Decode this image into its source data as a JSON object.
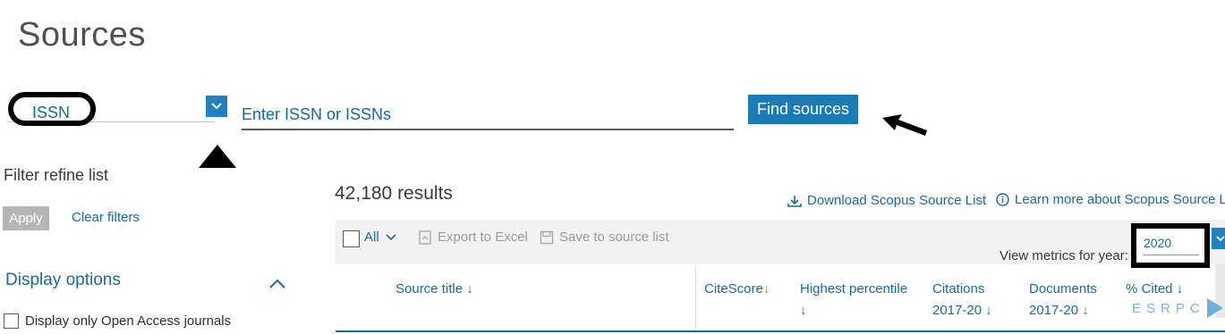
{
  "page": {
    "title": "Sources"
  },
  "search": {
    "type_value": "ISSN",
    "type_chevron_icon": "chevron-down-icon",
    "placeholder": "Enter ISSN or ISSNs",
    "find_label": "Find sources"
  },
  "annotations": {
    "up_arrow_icon": "arrow-up-icon",
    "left_arrow_icon": "arrow-left-icon"
  },
  "filter": {
    "title": "Filter refine list",
    "apply_label": "Apply",
    "clear_label": "Clear filters"
  },
  "display_options": {
    "label": "Display options",
    "collapse_icon": "chevron-up-icon",
    "open_access_label": "Display only Open Access journals"
  },
  "results": {
    "count_text": "42,180 results",
    "download_label": "Download Scopus Source List",
    "learn_label": "Learn more about Scopus Source Lis"
  },
  "toolbar": {
    "all_label": "All",
    "export_label": "Export to Excel",
    "save_label": "Save to source list",
    "view_metrics_label": "View metrics for year:",
    "year_value": "2020"
  },
  "table": {
    "headers": [
      {
        "line1": "Source title",
        "arrow": "↓"
      },
      {
        "line1": "CiteScore",
        "arrow": "↓"
      },
      {
        "line1": "Highest percentile",
        "line2": "↓"
      },
      {
        "line1": "Citations",
        "line2": "2017-20 ↓"
      },
      {
        "line1": "Documents",
        "line2": "2017-20 ↓"
      },
      {
        "line1": "% Cited ↓"
      }
    ]
  },
  "watermark": {
    "text": "ESRPC"
  },
  "colors": {
    "accent": "#1a7bb5",
    "link": "#1a6b96",
    "annotation": "#000000",
    "cite_arrow": "#e07020"
  }
}
